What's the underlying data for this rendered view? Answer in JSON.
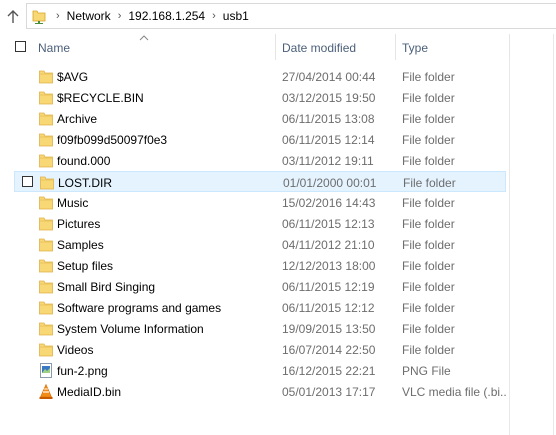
{
  "address": {
    "breadcrumbs": [
      "Network",
      "192.168.1.254",
      "usb1"
    ]
  },
  "columns": {
    "name": "Name",
    "date_modified": "Date modified",
    "type": "Type"
  },
  "files": [
    {
      "name": "$AVG",
      "date": "27/04/2014 00:44",
      "type": "File folder",
      "icon": "folder-icon"
    },
    {
      "name": "$RECYCLE.BIN",
      "date": "03/12/2015 19:50",
      "type": "File folder",
      "icon": "folder-icon"
    },
    {
      "name": "Archive",
      "date": "06/11/2015 13:08",
      "type": "File folder",
      "icon": "folder-icon"
    },
    {
      "name": "f09fb099d50097f0e3",
      "date": "06/11/2015 12:14",
      "type": "File folder",
      "icon": "folder-icon"
    },
    {
      "name": "found.000",
      "date": "03/11/2012 19:11",
      "type": "File folder",
      "icon": "folder-icon"
    },
    {
      "name": "LOST.DIR",
      "date": "01/01/2000 00:01",
      "type": "File folder",
      "icon": "folder-icon",
      "hover": true
    },
    {
      "name": "Music",
      "date": "15/02/2016 14:43",
      "type": "File folder",
      "icon": "folder-icon"
    },
    {
      "name": "Pictures",
      "date": "06/11/2015 12:13",
      "type": "File folder",
      "icon": "folder-icon"
    },
    {
      "name": "Samples",
      "date": "04/11/2012 21:10",
      "type": "File folder",
      "icon": "folder-icon"
    },
    {
      "name": "Setup files",
      "date": "12/12/2013 18:00",
      "type": "File folder",
      "icon": "folder-icon"
    },
    {
      "name": "Small Bird Singing",
      "date": "06/11/2015 12:19",
      "type": "File folder",
      "icon": "folder-icon"
    },
    {
      "name": "Software programs and games",
      "date": "06/11/2015 12:12",
      "type": "File folder",
      "icon": "folder-icon"
    },
    {
      "name": "System Volume Information",
      "date": "19/09/2015 13:50",
      "type": "File folder",
      "icon": "folder-icon"
    },
    {
      "name": "Videos",
      "date": "16/07/2014 22:50",
      "type": "File folder",
      "icon": "folder-icon"
    },
    {
      "name": "fun-2.png",
      "date": "16/12/2015 22:21",
      "type": "PNG File",
      "icon": "png-file-icon"
    },
    {
      "name": "MediaID.bin",
      "date": "05/01/2013 17:17",
      "type": "VLC media file (.bi...",
      "icon": "vlc-icon"
    }
  ]
}
